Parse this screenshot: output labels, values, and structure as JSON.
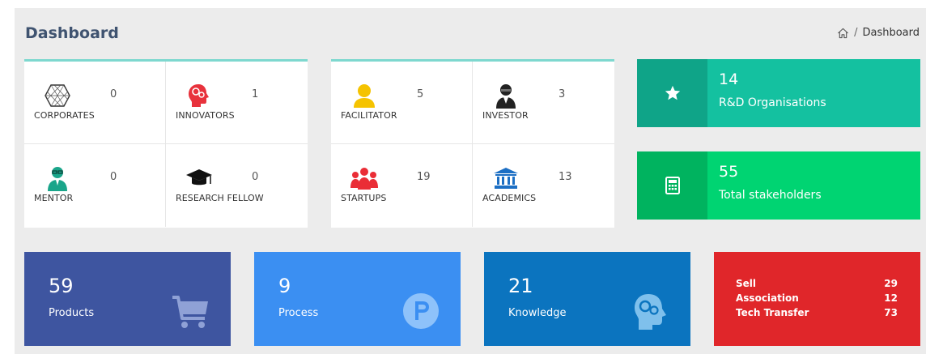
{
  "header": {
    "title": "Dashboard",
    "breadcrumb": {
      "separator": "/",
      "current": "Dashboard"
    }
  },
  "panel_left": {
    "cells": [
      {
        "label": "CORPORATES",
        "count": "0",
        "icon": "corporates-icon"
      },
      {
        "label": "INNOVATORS",
        "count": "1",
        "icon": "innovators-icon"
      },
      {
        "label": "MENTOR",
        "count": "0",
        "icon": "mentor-icon"
      },
      {
        "label": "RESEARCH FELLOW",
        "count": "0",
        "icon": "graduation-cap-icon"
      }
    ]
  },
  "panel_right": {
    "cells": [
      {
        "label": "FACILITATOR",
        "count": "5",
        "icon": "facilitator-icon"
      },
      {
        "label": "INVESTOR",
        "count": "3",
        "icon": "investor-icon"
      },
      {
        "label": "STARTUPS",
        "count": "19",
        "icon": "startups-icon"
      },
      {
        "label": "ACADEMICS",
        "count": "13",
        "icon": "academics-icon"
      }
    ]
  },
  "info_boxes": [
    {
      "number": "14",
      "text": "R&D Organisations",
      "icon": "star-icon"
    },
    {
      "number": "55",
      "text": "Total stakeholders",
      "icon": "calculator-icon"
    }
  ],
  "tiles": [
    {
      "number": "59",
      "text": "Products",
      "icon": "cart-icon"
    },
    {
      "number": "9",
      "text": "Process",
      "icon": "process-p-icon"
    },
    {
      "number": "21",
      "text": "Knowledge",
      "icon": "brain-icon"
    }
  ],
  "transfer_tile": {
    "rows": [
      {
        "label": "Sell",
        "value": "29"
      },
      {
        "label": "Association",
        "value": "12"
      },
      {
        "label": "Tech Transfer",
        "value": "73"
      }
    ]
  },
  "colors": {
    "page_bg": "#ececec",
    "title": "#3f5370",
    "panel_accent": "#7ed8cf",
    "rd_box": "#14c1a0",
    "stakeholders_box": "#00d472",
    "products_tile": "#3e55a0",
    "process_tile": "#3b8ff2",
    "knowledge_tile": "#0b74bf",
    "transfer_tile": "#e0262a"
  }
}
